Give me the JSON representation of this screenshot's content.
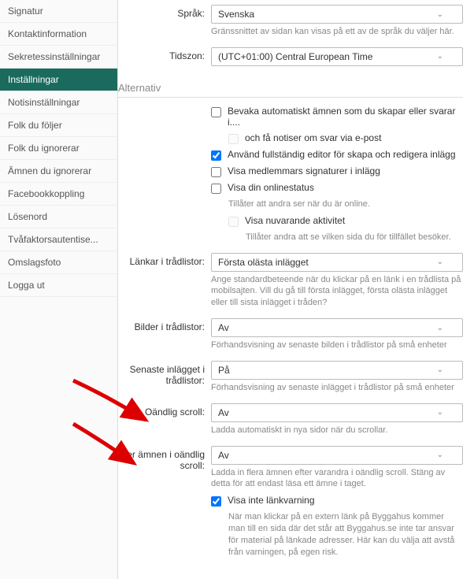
{
  "sidebar": {
    "items": [
      {
        "label": "Signatur"
      },
      {
        "label": "Kontaktinformation"
      },
      {
        "label": "Sekretessinställningar"
      },
      {
        "label": "Inställningar",
        "active": true
      },
      {
        "label": "Notisinställningar"
      },
      {
        "label": "Folk du följer"
      },
      {
        "label": "Folk du ignorerar"
      },
      {
        "label": "Ämnen du ignorerar"
      },
      {
        "label": "Facebookkoppling"
      },
      {
        "label": "Lösenord"
      },
      {
        "label": "Tvåfaktorsautentise..."
      },
      {
        "label": "Omslagsfoto"
      },
      {
        "label": "Logga ut"
      }
    ]
  },
  "fields": {
    "language": {
      "label": "Språk:",
      "value": "Svenska",
      "hint": "Gränssnittet av sidan kan visas på ett av de språk du väljer här."
    },
    "timezone": {
      "label": "Tidszon:",
      "value": "(UTC+01:00) Central European Time"
    },
    "linksInThread": {
      "label": "Länkar i trådlistor:",
      "value": "Första olästa inlägget",
      "hint": "Ange standardbeteende när du klickar på en länk i en trådlista på mobilsajten. Vill du gå till första inlägget, första olästa inlägget eller till sista inlägget i tråden?"
    },
    "imagesInThread": {
      "label": "Bilder i trådlistor:",
      "value": "Av",
      "hint": "Förhandsvisning av senaste bilden i trådlistor på små enheter"
    },
    "latestPost": {
      "label": "Senaste inlägget i trådlistor:",
      "value": "På",
      "hint": "Förhandsvisning av senaste inlägget i trådlistor på små enheter"
    },
    "infiniteScroll": {
      "label": "Oändlig scroll:",
      "value": "Av",
      "hint": "Ladda automatiskt in nya sidor när du scrollar."
    },
    "moreTopics": {
      "label": "Fler ämnen i oändlig scroll:",
      "value": "Av",
      "hint": "Ladda in flera ämnen efter varandra i oändlig scroll. Stäng av detta för att endast läsa ett ämne i taget."
    }
  },
  "sections": {
    "alternatives": "Alternativ"
  },
  "checkboxes": {
    "watchAuto": "Bevaka automatiskt ämnen som du skapar eller svarar i....",
    "emailNotif": "och få notiser om svar via e-post",
    "fullEditor": "Använd fullständig editor för skapa och redigera inlägg",
    "showSignatures": "Visa medlemmars signaturer i inlägg",
    "showOnline": "Visa din onlinestatus",
    "showOnlineHint": "Tillåter att andra ser när du är online.",
    "showActivity": "Visa nuvarande aktivitet",
    "showActivityHint": "Tillåter andra att se vilken sida du för tillfället besöker.",
    "hideLinkWarning": "Visa inte länkvarning",
    "hideLinkWarningHint": "När man klickar på en extern länk på Byggahus kommer man till en sida där det står att Byggahus.se inte tar ansvar för material på länkade adresser. Här kan du välja att avstå från varningen, på egen risk."
  }
}
